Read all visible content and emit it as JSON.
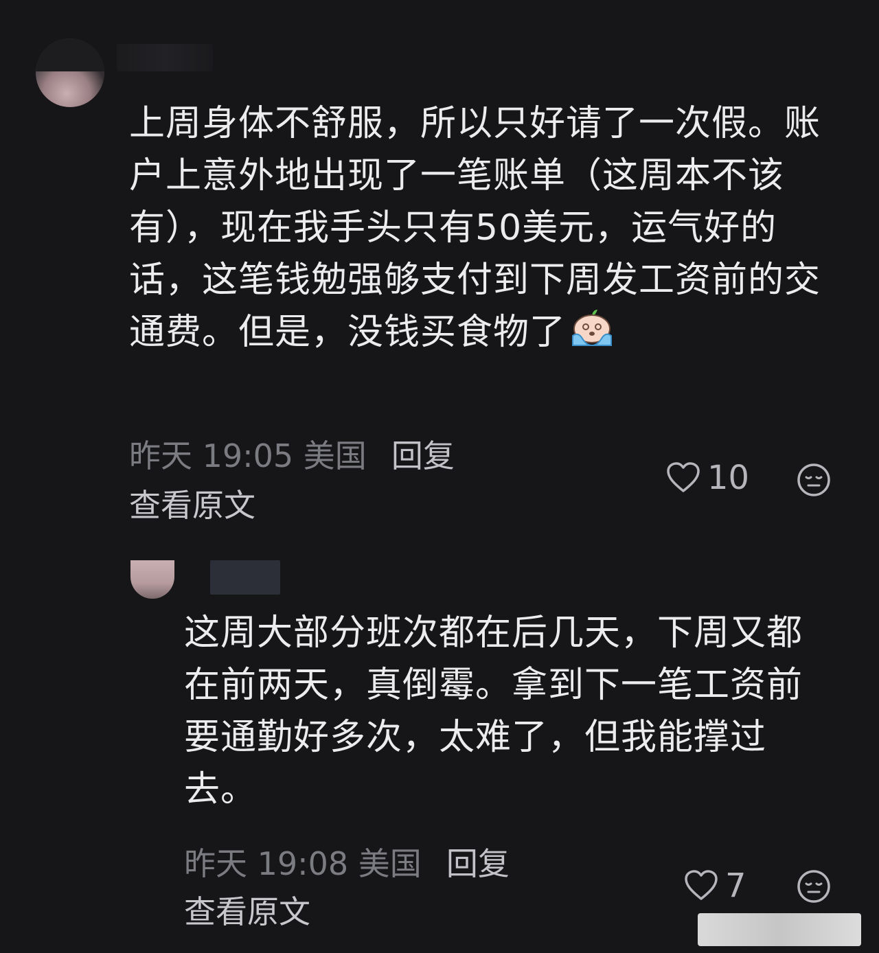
{
  "comments": [
    {
      "text": "上周身体不舒服，所以只好请了一次假。账户上意外地出现了一笔账单（这周本不该有），现在我手头只有50美元，运气好的话，这笔钱勉强够支付到下周发工资前的交通费。但是，没钱买食物了",
      "emoji": "crying-face-emoji",
      "time": "昨天 19:05 美国",
      "reply_label": "回复",
      "view_original": "查看原文",
      "likes": "10"
    },
    {
      "text": "这周大部分班次都在后几天，下周又都在前两天，真倒霉。拿到下一笔工资前要通勤好多次，太难了，但我能撑过去。",
      "time": "昨天 19:08 美国",
      "reply_label": "回复",
      "view_original": "查看原文",
      "likes": "7"
    }
  ],
  "colors": {
    "background": "#161619",
    "text": "#ececef",
    "meta": "#7b7b82",
    "icon": "#b5b5bb"
  }
}
